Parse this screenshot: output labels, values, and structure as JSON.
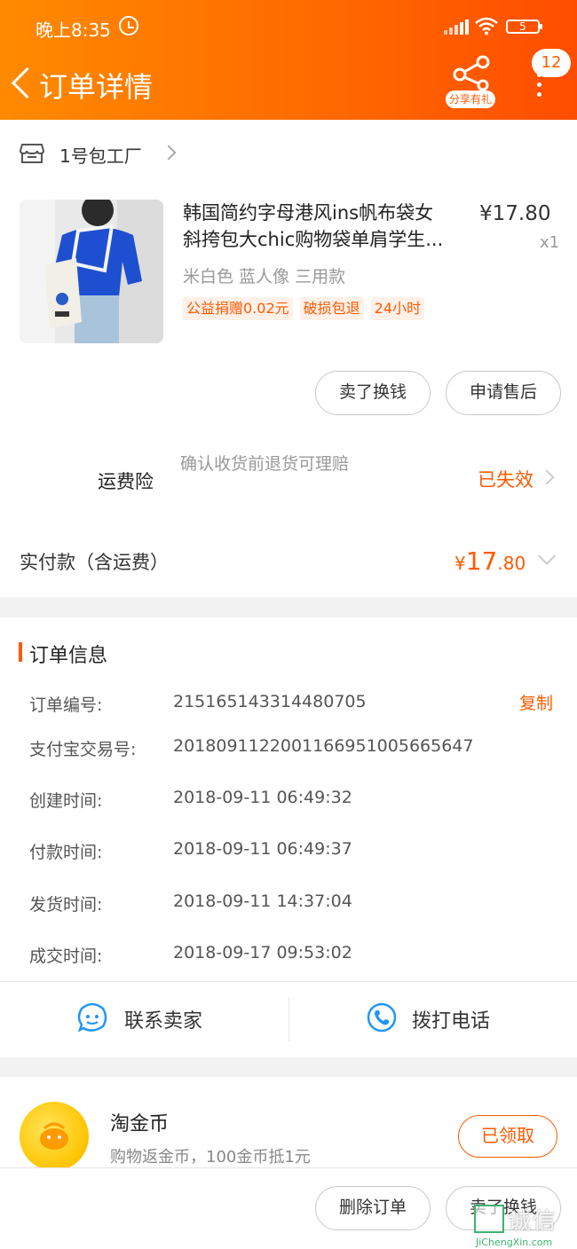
{
  "status_bar": {
    "time": "晚上8:35",
    "battery": "5"
  },
  "header": {
    "title": "订单详情",
    "share_label": "分享有礼",
    "badge_count": "12"
  },
  "shop": {
    "name": "1号包工厂"
  },
  "product": {
    "title_line1": "韩国简约字母港风ins帆布袋女",
    "title_line2": "斜挎包大chic购物袋单肩学生...",
    "price": "¥17.80",
    "quantity": "x1",
    "sku": "米白色 蓝人像 三用款",
    "tags": [
      "公益捐赠0.02元",
      "破损包退",
      "24小时"
    ]
  },
  "actions": {
    "sell_label": "卖了换钱",
    "after_sale_label": "申请售后"
  },
  "insurance": {
    "label": "运费险",
    "description": "确认收货前退货可理赔",
    "status": "已失效"
  },
  "payment": {
    "label": "实付款（含运费）",
    "currency": "¥",
    "amount_int": "17",
    "amount_dec": ".80"
  },
  "order_info": {
    "title": "订单信息",
    "copy_label": "复制",
    "rows": [
      {
        "key": "订单编号:",
        "value": "215165143314480705"
      },
      {
        "key": "支付宝交易号:",
        "value": "2018091122001166951005665647"
      },
      {
        "key": "创建时间:",
        "value": "2018-09-11 06:49:32"
      },
      {
        "key": "付款时间:",
        "value": "2018-09-11 06:49:37"
      },
      {
        "key": "发货时间:",
        "value": "2018-09-11 14:37:04"
      },
      {
        "key": "成交时间:",
        "value": "2018-09-17 09:53:02"
      }
    ]
  },
  "contact": {
    "seller_label": "联系卖家",
    "phone_label": "拨打电话"
  },
  "coins": {
    "title": "淘金币",
    "subtitle": "购物返金币，100金币抵1元",
    "status": "已领取"
  },
  "bottom_bar": {
    "delete_label": "删除订单",
    "sell_label": "卖了换钱"
  },
  "watermark": {
    "text": "诚信",
    "url": "JiChengXin.com"
  },
  "colors": {
    "accent": "#ff5a00",
    "header_start": "#ff8a00",
    "header_end": "#ff4d00"
  }
}
